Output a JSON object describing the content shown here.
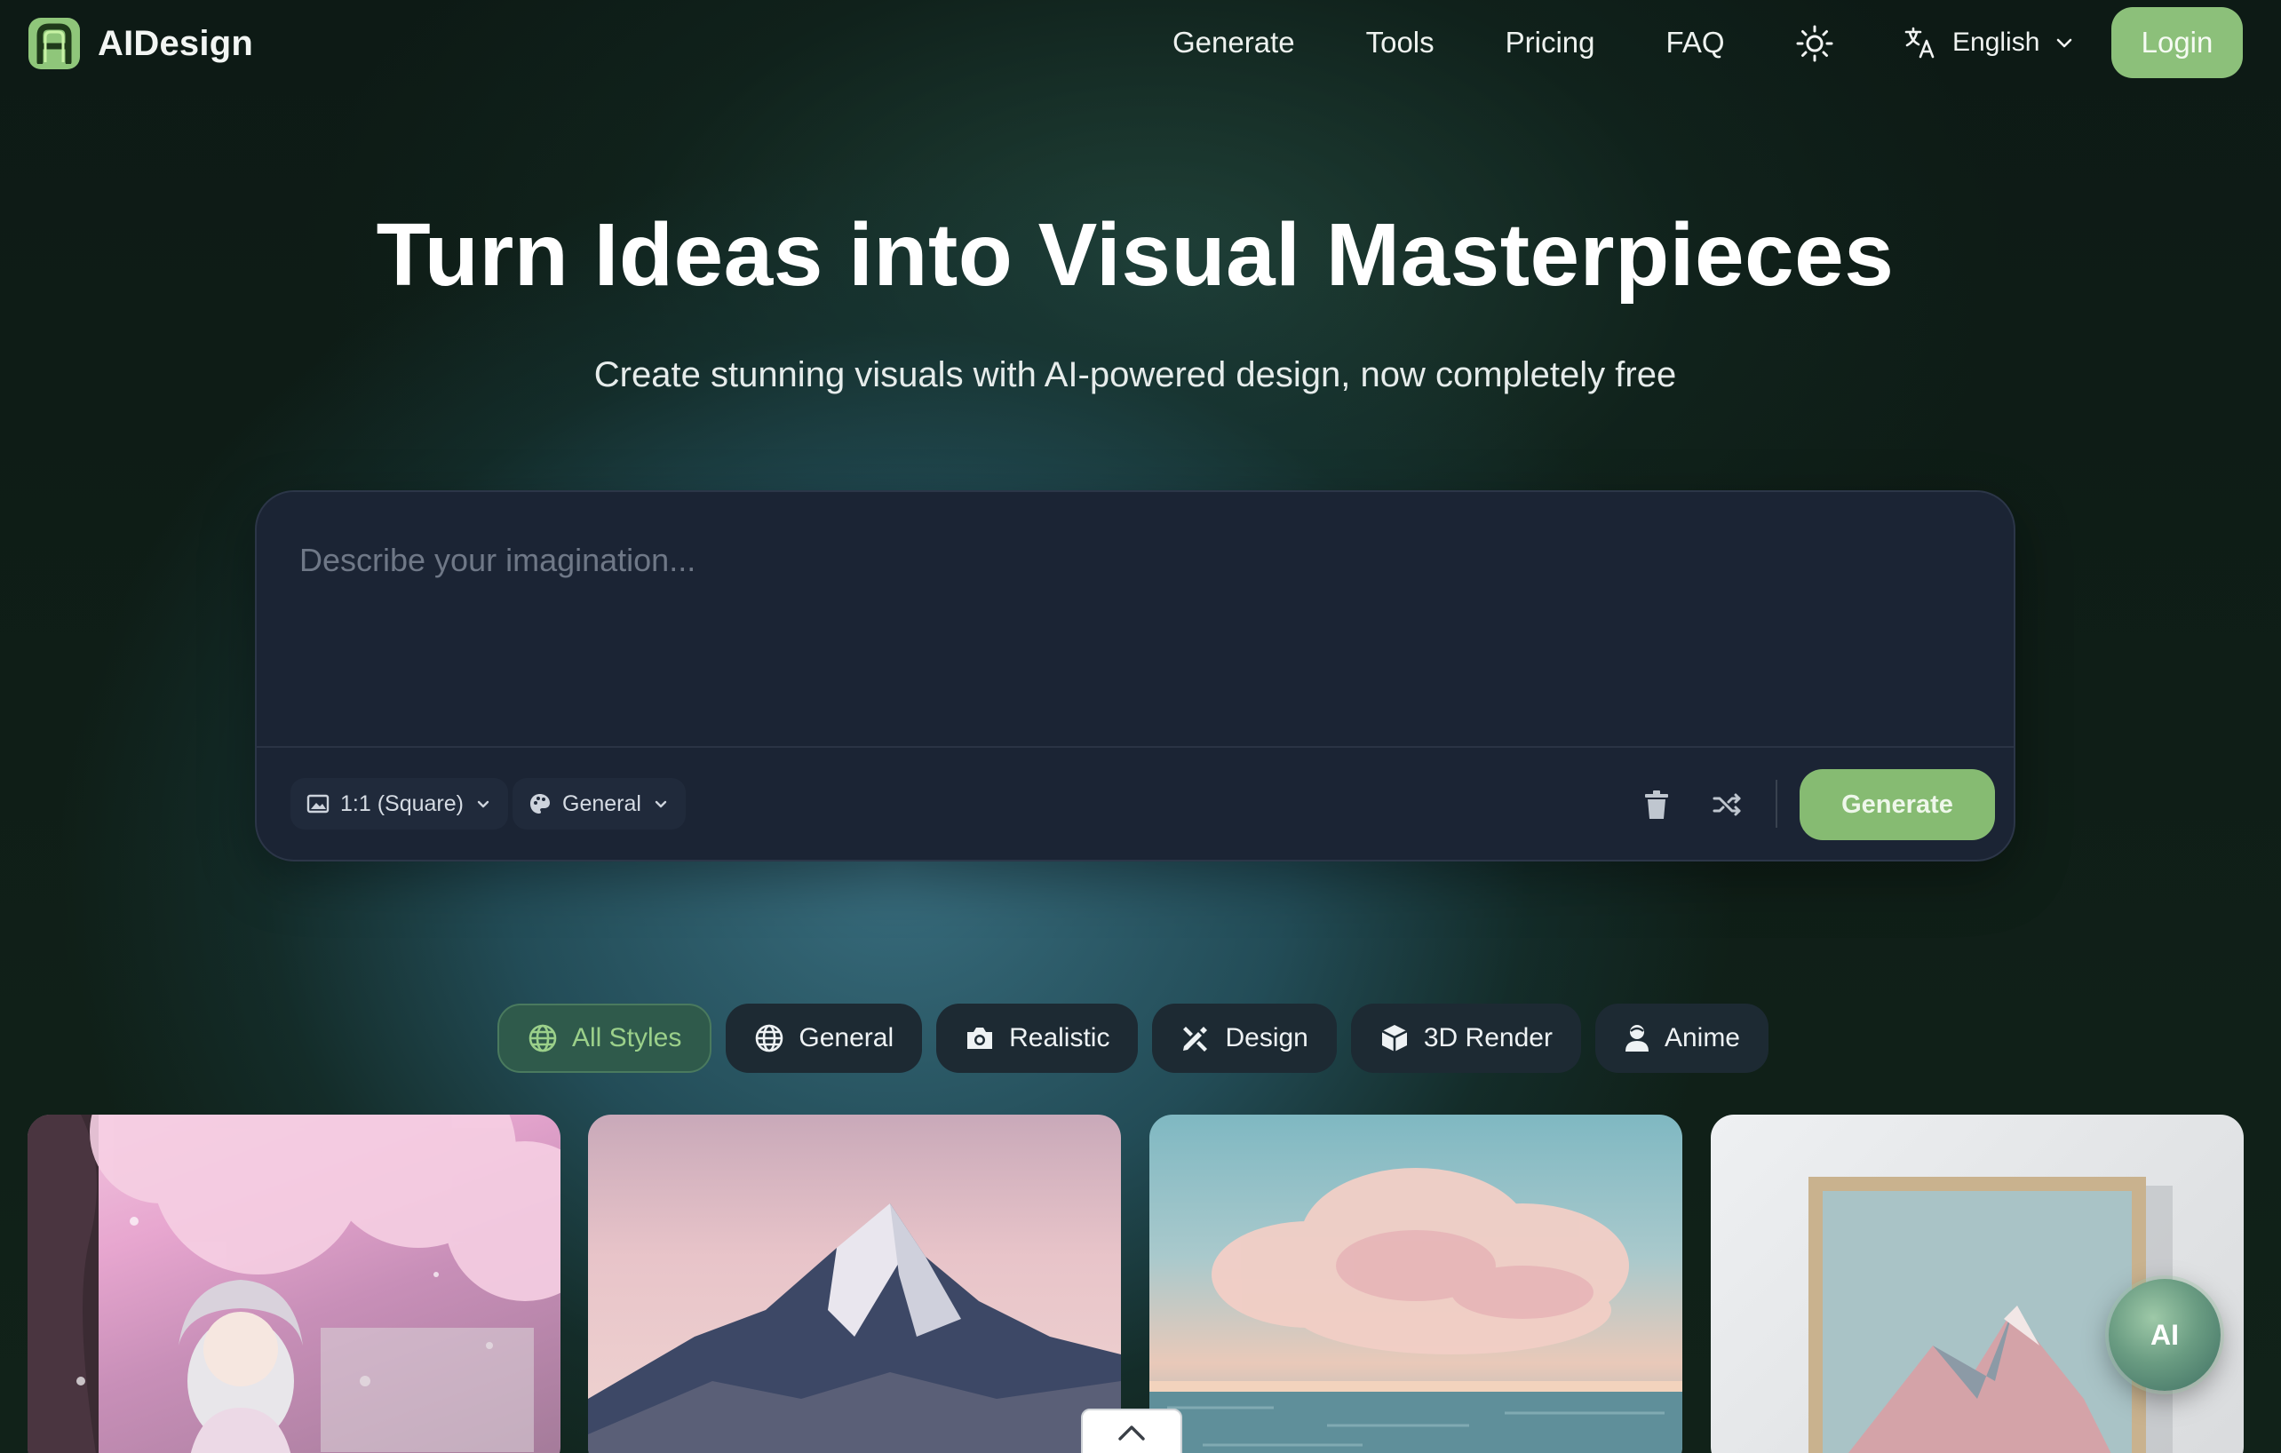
{
  "brand": {
    "name": "AIDesign",
    "logo_letter": "A",
    "accent_color": "#8cc07a"
  },
  "nav": {
    "links": [
      "Generate",
      "Tools",
      "Pricing",
      "FAQ"
    ],
    "theme_icon": "sun-icon",
    "language": "English",
    "login_label": "Login"
  },
  "hero": {
    "title": "Turn Ideas into Visual Masterpieces",
    "subtitle": "Create stunning visuals with AI-powered design, now completely free"
  },
  "prompt": {
    "placeholder": "Describe your imagination...",
    "value": "",
    "aspect_ratio": "1:1 (Square)",
    "style": "General",
    "generate_label": "Generate"
  },
  "style_tabs": [
    {
      "label": "All Styles",
      "icon": "globe-icon",
      "active": true
    },
    {
      "label": "General",
      "icon": "globe-icon",
      "active": false
    },
    {
      "label": "Realistic",
      "icon": "camera-icon",
      "active": false
    },
    {
      "label": "Design",
      "icon": "design-tools-icon",
      "active": false
    },
    {
      "label": "3D Render",
      "icon": "cube-icon",
      "active": false
    },
    {
      "label": "Anime",
      "icon": "anime-user-icon",
      "active": false
    }
  ],
  "gallery": [
    {
      "subject": "anime girl under cherry blossoms"
    },
    {
      "subject": "snowy mountain at pink dusk"
    },
    {
      "subject": "clouds over ocean"
    },
    {
      "subject": "framed mountain poster"
    }
  ],
  "assistant_label": "AI"
}
